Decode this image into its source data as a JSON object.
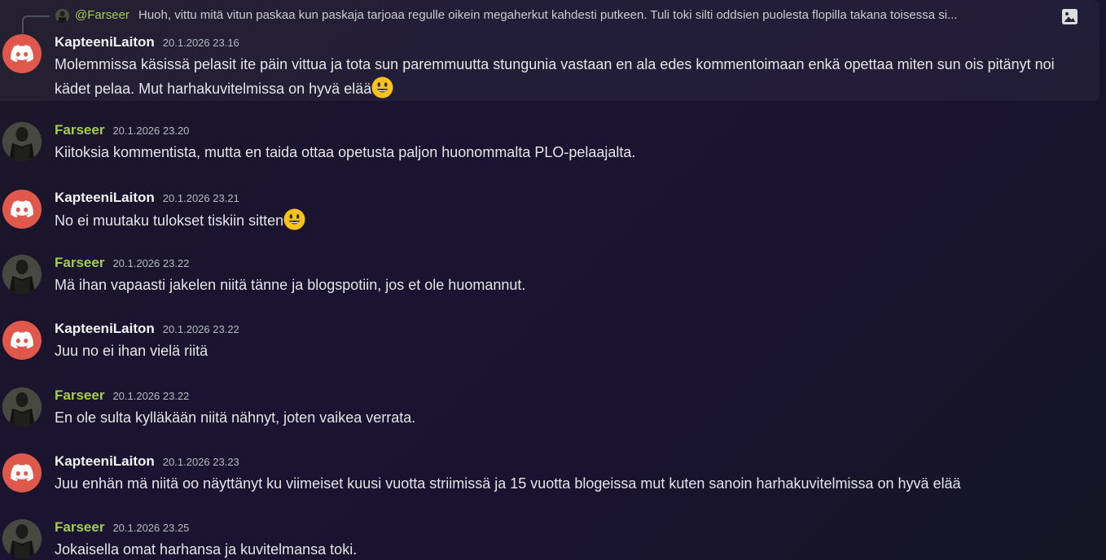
{
  "reply": {
    "mention": "@Farseer",
    "text": "Huoh, vittu mitä vitun paskaa kun paskaja tarjoaa regulle oikein megaherkut kahdesti putkeen. Tuli toki silti oddsien puolesta flopilla takana toisessa si...",
    "attachment_icon": "image-icon"
  },
  "messages": [
    {
      "username": "KapteeniLaiton",
      "timestamp": "20.1.2026 23.16",
      "text": "Molemmissa käsissä pelasit ite päin vittua ja tota sun paremmuutta stungunia vastaan en ala edes kommentoimaan enkä opettaa miten sun ois pitänyt noi kädet pelaa. Mut harhakuvitelmissa on hyvä elää",
      "emoji": "smiley-emoji"
    },
    {
      "username": "Farseer",
      "timestamp": "20.1.2026 23.20",
      "text": "Kiitoksia kommentista, mutta en taida ottaa opetusta paljon huonommalta PLO-pelaajalta."
    },
    {
      "username": "KapteeniLaiton",
      "timestamp": "20.1.2026 23.21",
      "text": "No ei muutaku tulokset tiskiin sitten",
      "emoji": "smiley-emoji"
    },
    {
      "username": "Farseer",
      "timestamp": "20.1.2026 23.22",
      "text": "Mä ihan vapaasti jakelen niitä tänne ja blogspotiin, jos et ole huomannut."
    },
    {
      "username": "KapteeniLaiton",
      "timestamp": "20.1.2026 23.22",
      "text": "Juu no ei ihan vielä riitä"
    },
    {
      "username": "Farseer",
      "timestamp": "20.1.2026 23.22",
      "text": "En ole sulta kylläkään niitä nähnyt, joten vaikea verrata."
    },
    {
      "username": "KapteeniLaiton",
      "timestamp": "20.1.2026 23.23",
      "text": "Juu enhän mä niitä oo näyttänyt ku viimeiset kuusi vuotta striimissä ja 15 vuotta blogeissa mut kuten sanoin harhakuvitelmissa on hyvä elää"
    },
    {
      "username": "Farseer",
      "timestamp": "20.1.2026 23.25",
      "text": "Jokaisella omat harhansa ja kuvitelmansa toki."
    }
  ],
  "colors": {
    "farseer_name": "#a7cd4e",
    "discord_avatar": "#e0574c",
    "text": "#e3e5e8",
    "timestamp": "#b5bac1"
  }
}
